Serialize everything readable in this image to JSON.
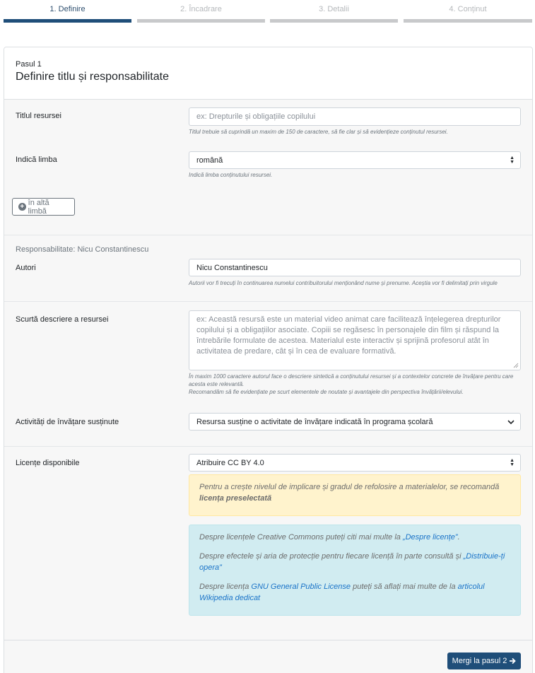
{
  "stepper": {
    "steps": [
      {
        "label": "1. Definire"
      },
      {
        "label": "2. Încadrare"
      },
      {
        "label": "3. Detalii"
      },
      {
        "label": "4. Conținut"
      }
    ]
  },
  "card": {
    "step_label": "Pasul 1",
    "title": "Definire titlu și responsabilitate"
  },
  "title_field": {
    "label": "Titlul resursei",
    "placeholder": "ex: Drepturile și obligațiile copilului",
    "help": "Titlul trebuie să cuprindă un maxim de 150 de caractere, să fie clar și să evidențieze conținutul resursei."
  },
  "language_field": {
    "label": "Indică limba",
    "value": "română",
    "help": "Indică limba conținutului resursei."
  },
  "other_language_button": "în altă limbă",
  "responsibility": {
    "heading": "Responsabilitate: Nicu Constantinescu",
    "authors_label": "Autori",
    "authors_value": "Nicu Constantinescu",
    "authors_help": "Autorii vor fi trecuți în continuarea numelui contribuitorului menționând nume și prenume. Aceștia vor fi delimitați prin virgule"
  },
  "description_field": {
    "label": "Scurtă descriere a resursei",
    "placeholder": "ex: Această resursă este un material video animat care facilitează înțelegerea drepturilor copilului și a obligațiilor asociate. Copiii se regăsesc în personajele din film și răspund la întrebările formulate de acestea. Materialul este interactiv și sprijină profesorul atât în activitatea de predare, cât și în cea de evaluare formativă.",
    "help1": "În maxim 1000 caractere autorul face o descriere sintetică a conținutului resursei și a contextelor concrete de învățare pentru care acesta este relevantă.",
    "help2": "Recomandăm să fie evidențiate pe scurt elementele de noutate și avantajele din perspectiva învățării/elevului."
  },
  "activities_field": {
    "label": "Activități de învățare susținute",
    "value": "Resursa susține o activitate de învățare indicată în programa școlară"
  },
  "license_field": {
    "label": "Licențe disponibile",
    "value": "Atribuire CC BY 4.0",
    "warning_text": "Pentru a crește nivelul de implicare și gradul de refolosire a materialelor, se recomandă",
    "warning_bold": "licența preselectată",
    "info1_text": "Despre licențele Creative Commons puteți citi mai multe la",
    "info1_link": "„Despre licențe”",
    "info2_text": "Despre efectele și aria de protecție pentru fiecare licență în parte consultă și",
    "info2_link": "„Distribuie-ți opera”",
    "info3_pre": "Despre licența",
    "info3_link1": "GNU General Public License",
    "info3_mid": "puteți să aflați mai multe de la",
    "info3_link2": "articolul Wikipedia dedicat"
  },
  "next_button": "Mergi la pasul 2"
}
